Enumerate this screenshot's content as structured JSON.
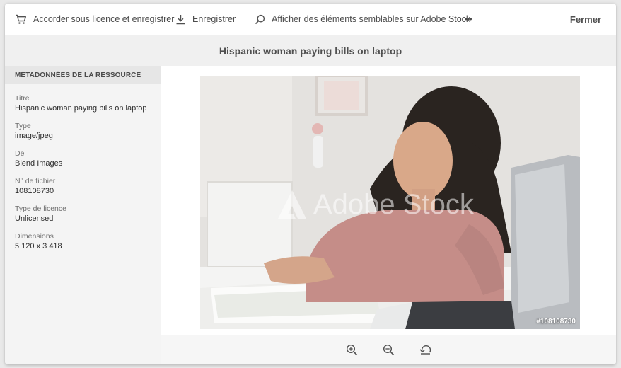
{
  "toolbar": {
    "license_save_label": "Accorder sous licence et enregistrer",
    "save_label": "Enregistrer",
    "find_similar_label": "Afficher des éléments semblables sur Adobe Stock",
    "more_label": "•••",
    "close_label": "Fermer"
  },
  "title": "Hispanic woman paying bills on laptop",
  "sidebar": {
    "header": "MÉTADONNÉES DE LA RESSOURCE",
    "items": [
      {
        "label": "Titre",
        "value": "Hispanic woman paying bills on laptop"
      },
      {
        "label": "Type",
        "value": "image/jpeg"
      },
      {
        "label": "De",
        "value": "Blend Images"
      },
      {
        "label": "N° de fichier",
        "value": "108108730"
      },
      {
        "label": "Type de licence",
        "value": "Unlicensed"
      },
      {
        "label": "Dimensions",
        "value": "5 120 x 3 418"
      }
    ]
  },
  "preview": {
    "watermark": "Adobe Stock",
    "file_id": "#108108730"
  },
  "icons": {
    "cart": "cart-icon",
    "download": "download-icon",
    "search": "search-icon",
    "zoom_in": "zoom-in-icon",
    "zoom_out": "zoom-out-icon",
    "reset": "reset-icon"
  }
}
